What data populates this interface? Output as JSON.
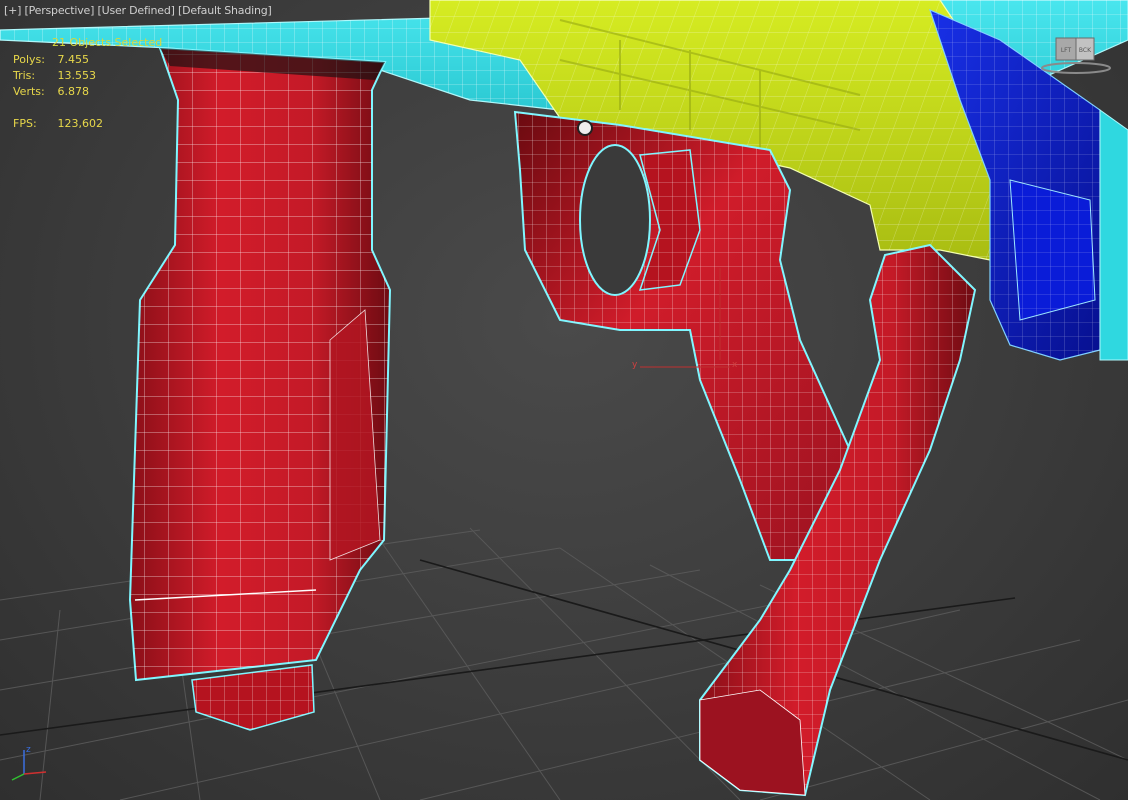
{
  "viewport": {
    "label_menu": "[+]",
    "label_view": "[Perspective]",
    "label_camera": "[User Defined]",
    "label_shading": "[Default Shading]"
  },
  "selection": {
    "text": "21 Objects Selected"
  },
  "stats": {
    "polys_label": "Polys:",
    "polys_value": "7.455",
    "tris_label": "Tris:",
    "tris_value": "13.553",
    "verts_label": "Verts:",
    "verts_value": "6.878",
    "fps_label": "FPS:",
    "fps_value": "123,602"
  },
  "viewcube": {
    "left_face": "LFT",
    "front_face": "BCK"
  },
  "axes": {
    "x": "x",
    "y": "y",
    "z": "z"
  },
  "colors": {
    "grip_red": "#d01c2a",
    "body_yellow": "#c6dc1a",
    "rail_cyan": "#2fd8e0",
    "stock_blue": "#0c1fc8",
    "wire": "#ffffff"
  }
}
